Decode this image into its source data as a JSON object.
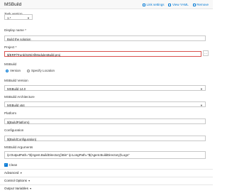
{
  "header": {
    "title": "MSBuild",
    "actions": [
      {
        "label": "Link settings",
        "icon": "link-icon"
      },
      {
        "label": "View YAML",
        "icon": "clipboard-icon"
      },
      {
        "label": "Remove",
        "icon": "trash-icon"
      }
    ]
  },
  "task_version": {
    "label": "Task version",
    "value": "1.*"
  },
  "display_name": {
    "label": "Display name *",
    "value": "Build the solution"
  },
  "project": {
    "label": "Project *",
    "value": "$/ERP/Trunk/S25/AllModulesBuild.proj",
    "browse": "..."
  },
  "msbuild": {
    "label": "MSBuild",
    "options": [
      "Version",
      "Specify Location"
    ],
    "selected": "Version"
  },
  "msbuild_version": {
    "label": "MSBuild Version",
    "value": "MSBuild 14.0"
  },
  "msbuild_arch": {
    "label": "MSBuild Architecture",
    "value": "MSBuild x64"
  },
  "platform": {
    "label": "Platform",
    "value": "$(BuildPlatform)"
  },
  "configuration": {
    "label": "Configuration",
    "value": "$(BuildConfiguration)"
  },
  "msbuild_args": {
    "label": "MSBuild Arguments",
    "value": "/p:OutputPath=\"$(Agent.BuildDirectory)\\Bin\" /p:LongPath=\"$(Agent.BuildDirectory)\\Logs\""
  },
  "clean": {
    "label": "Clean",
    "checked": true
  },
  "sections": [
    "Advanced",
    "Control Options",
    "Output Variables"
  ],
  "colors": {
    "accent": "#0078d4",
    "error_border": "#d9534f"
  }
}
